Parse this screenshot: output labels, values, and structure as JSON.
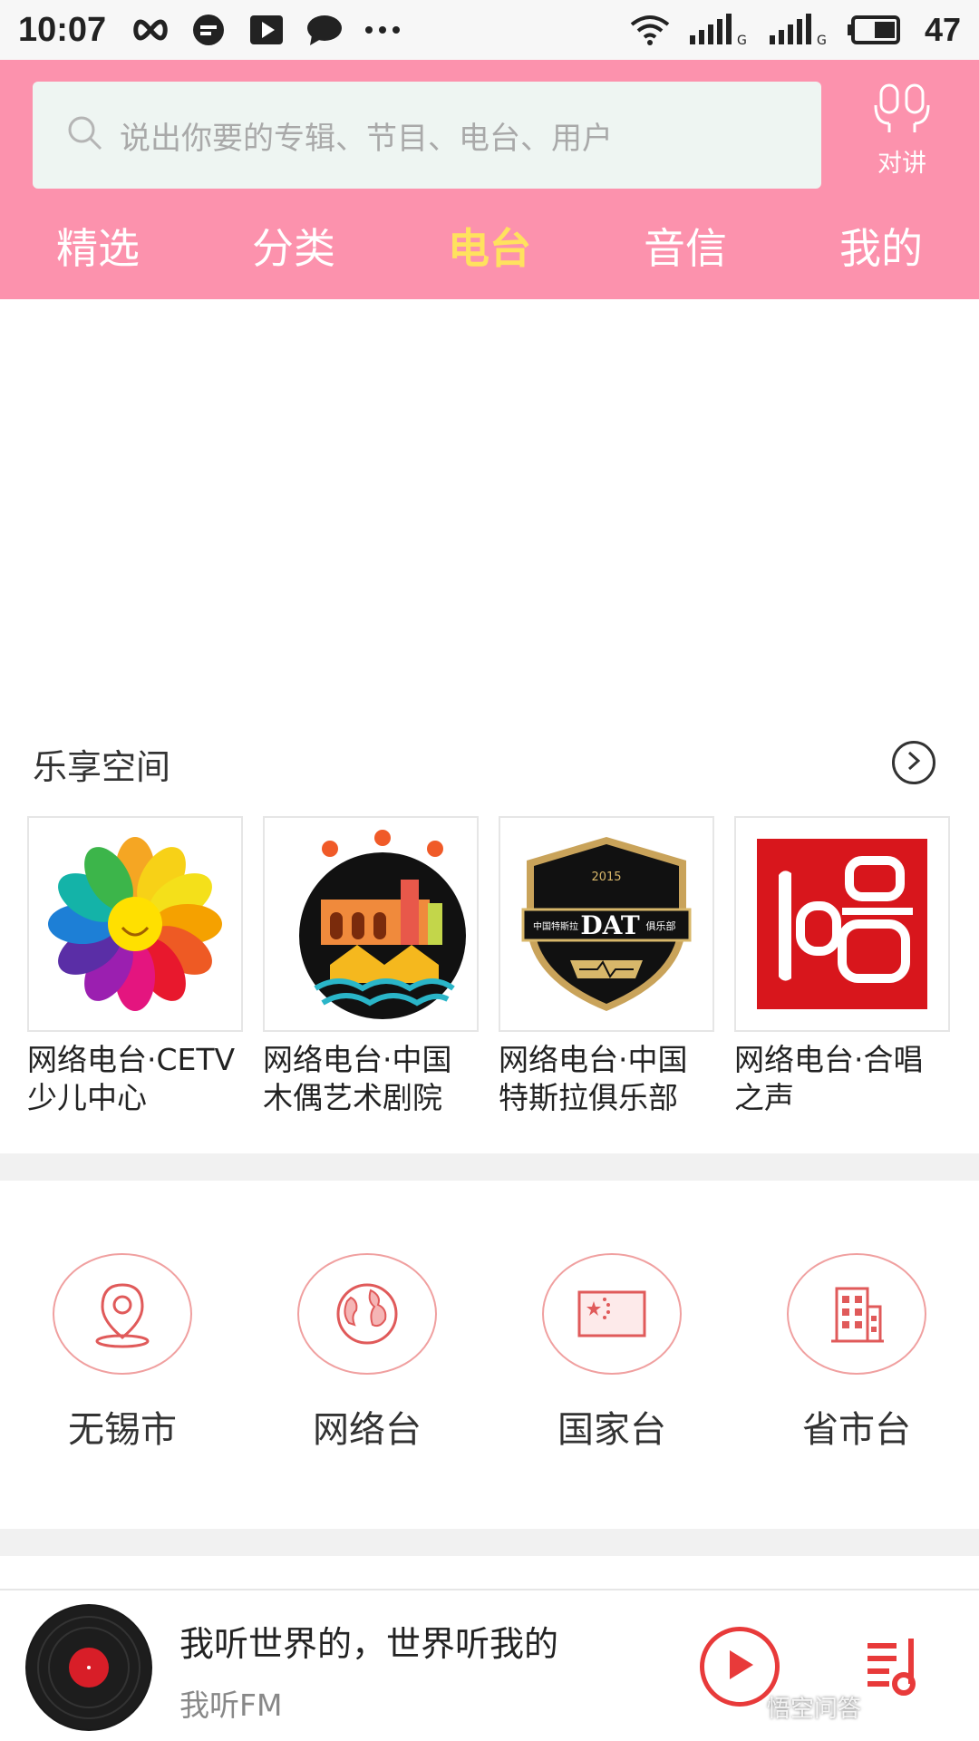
{
  "status_bar": {
    "time": "10:07",
    "battery": "47",
    "icons": [
      "infinity-icon",
      "message-icon",
      "play-icon",
      "chat-icon",
      "more-dots-icon",
      "wifi-icon",
      "signal-icon",
      "signal-icon",
      "battery-icon"
    ]
  },
  "header": {
    "search_placeholder": "说出你要的专辑、节目、电台、用户",
    "talk_label": "对讲",
    "tabs": [
      {
        "label": "精选",
        "active": false
      },
      {
        "label": "分类",
        "active": false
      },
      {
        "label": "电台",
        "active": true
      },
      {
        "label": "音信",
        "active": false
      },
      {
        "label": "我的",
        "active": false
      }
    ]
  },
  "featured": {
    "title": "乐享空间",
    "stations": [
      {
        "name": "网络电台·CETV少儿中心"
      },
      {
        "name": "网络电台·中国木偶艺术剧院"
      },
      {
        "name": "网络电台·中国特斯拉俱乐部",
        "logo_text": "DAT",
        "logo_small_left": "中国特斯拉",
        "logo_small_right": "俱乐部",
        "logo_year": "2015"
      },
      {
        "name": "网络电台·合唱之声"
      }
    ]
  },
  "regions": [
    {
      "label": "无锡市",
      "icon": "location-pin-icon"
    },
    {
      "label": "网络台",
      "icon": "globe-icon"
    },
    {
      "label": "国家台",
      "icon": "flag-icon"
    },
    {
      "label": "省市台",
      "icon": "building-icon"
    }
  ],
  "player": {
    "title": "我听世界的，世界听我的",
    "subtitle": "我听FM"
  },
  "watermark": "悟空问答",
  "colors": {
    "header_pink": "#fc92ad",
    "active_tab": "#ffe25e",
    "accent_red": "#e83a3a"
  }
}
